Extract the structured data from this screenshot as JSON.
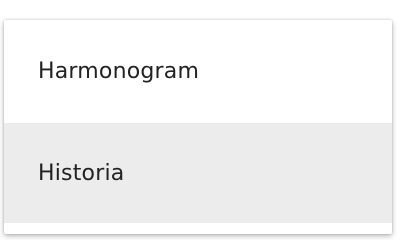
{
  "menu": {
    "items": [
      {
        "label": "Harmonogram",
        "highlighted": false
      },
      {
        "label": "Historia",
        "highlighted": true
      }
    ],
    "colors": {
      "panel_background": "#ffffff",
      "highlight_background": "#ececec",
      "text": "#222222"
    }
  }
}
